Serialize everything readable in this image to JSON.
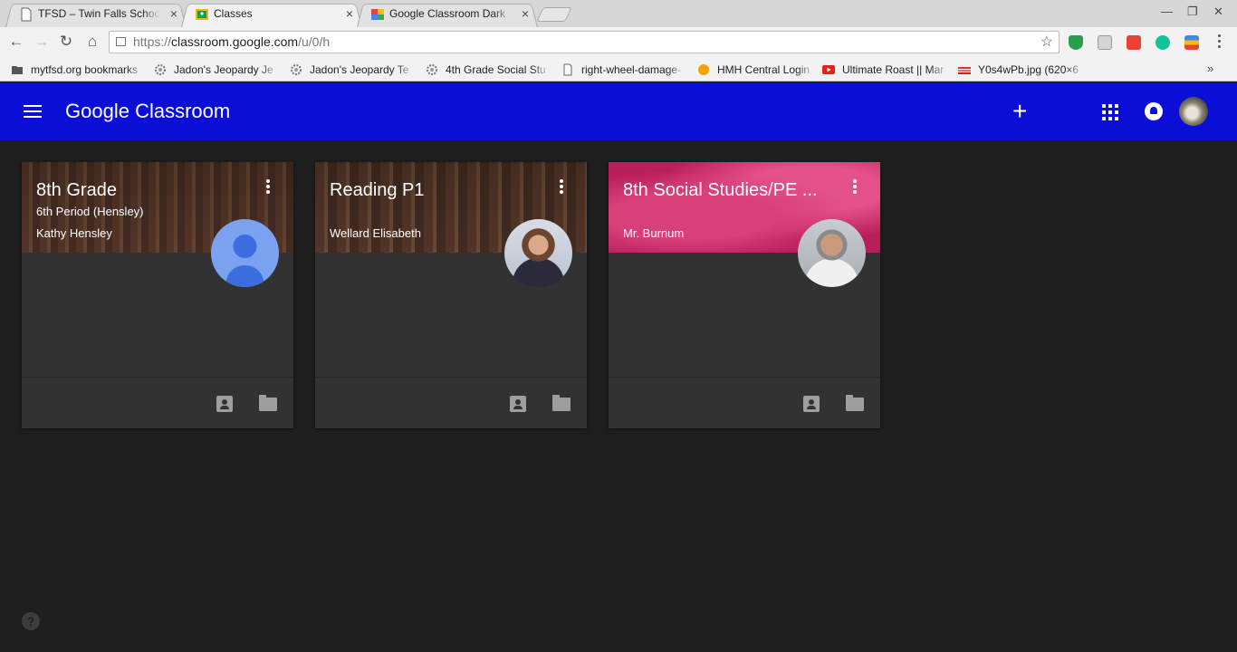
{
  "browser": {
    "tabs": [
      {
        "title": "TFSD – Twin Falls School",
        "icon": "document-icon",
        "active": false
      },
      {
        "title": "Classes",
        "icon": "classroom-icon",
        "active": true
      },
      {
        "title": "Google Classroom Dark",
        "icon": "webstore-icon",
        "active": false
      }
    ],
    "tab_close_glyph": "×",
    "url_scheme": "https://",
    "url_host": "classroom.google.com",
    "url_path": "/u/0/h",
    "bookmarks": [
      {
        "label": "mytfsd.org bookmarks",
        "icon": "folder-icon"
      },
      {
        "label": "Jadon's Jeopardy Je",
        "icon": "gear-icon"
      },
      {
        "label": "Jadon's Jeopardy Te",
        "icon": "gear-icon"
      },
      {
        "label": "4th Grade Social Stu",
        "icon": "gear-icon"
      },
      {
        "label": "right-wheel-damage-",
        "icon": "document-icon"
      },
      {
        "label": "HMH Central Login",
        "icon": "orange-circle-icon"
      },
      {
        "label": "Ultimate Roast || Mar",
        "icon": "youtube-icon"
      },
      {
        "label": "Y0s4wPb.jpg (620×6",
        "icon": "image-icon"
      }
    ],
    "bookmarks_overflow": "»"
  },
  "app": {
    "brand_google": "Google",
    "brand_product": "Classroom",
    "header_color": "#0a0ed6"
  },
  "classes": [
    {
      "title": "8th Grade",
      "section": "6th Period (Hensley)",
      "teacher": "Kathy Hensley",
      "theme": "brown"
    },
    {
      "title": "Reading P1",
      "section": "",
      "teacher": "Wellard Elisabeth",
      "theme": "brown"
    },
    {
      "title": "8th Social Studies/PE ...",
      "section": "",
      "teacher": "Mr. Burnum",
      "theme": "pink"
    }
  ],
  "help_glyph": "?"
}
